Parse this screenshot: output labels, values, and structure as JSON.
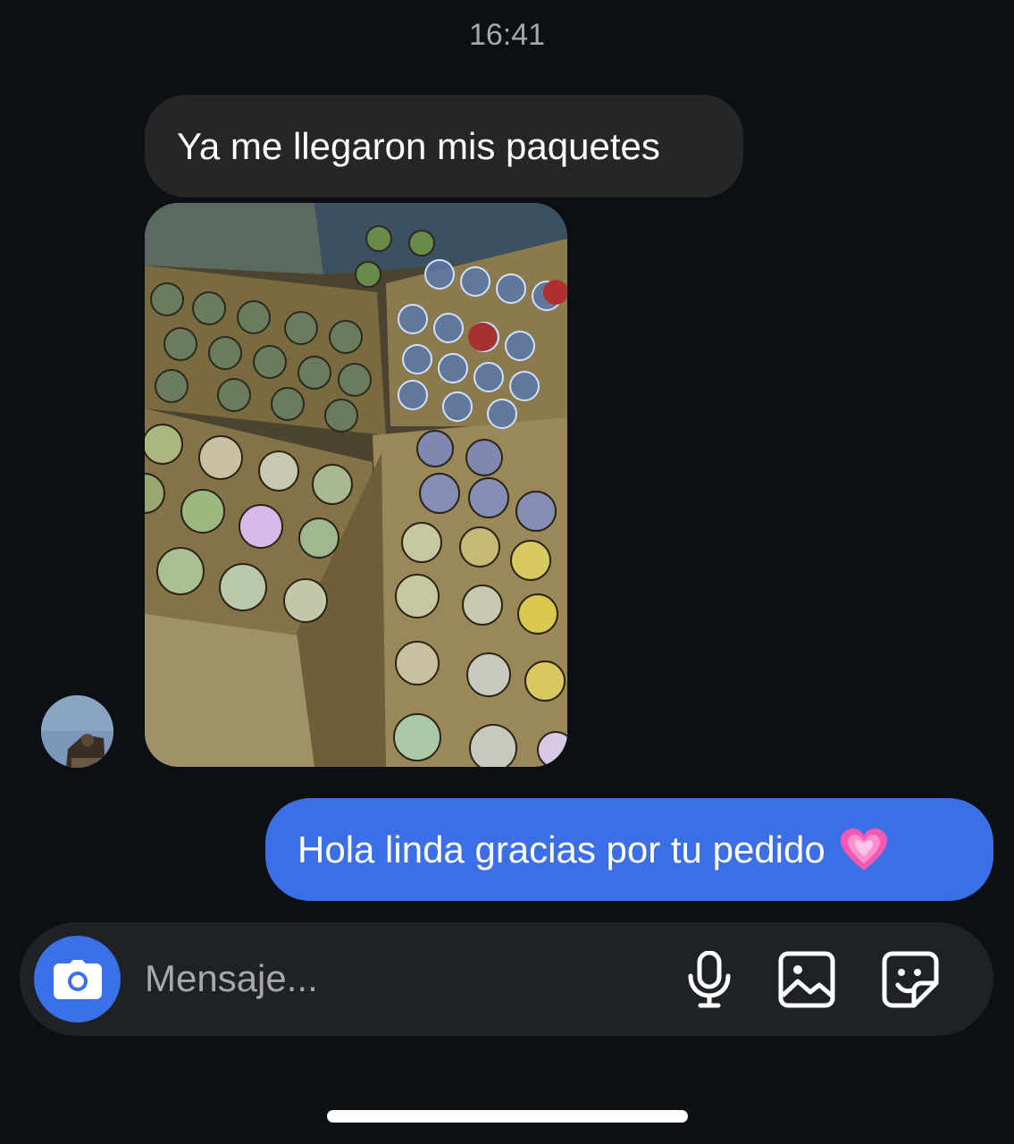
{
  "status": {
    "time": "16:41"
  },
  "conversation": {
    "incoming_text": "Ya me llegaron mis paquetes",
    "incoming_photo_icon": "photo-of-perfume-boxes",
    "outgoing_text": "Hola linda gracias por tu pedido",
    "outgoing_emoji": "growing-heart-emoji"
  },
  "composer": {
    "placeholder": "Mensaje...",
    "camera_icon": "camera-icon",
    "mic_icon": "microphone-icon",
    "gallery_icon": "gallery-icon",
    "sticker_icon": "sticker-icon"
  },
  "colors": {
    "background": "#0c1014",
    "incoming_bubble": "#262626",
    "outgoing_bubble": "#3c6fe6",
    "composer": "#1e2227",
    "accent": "#3a70e8"
  }
}
